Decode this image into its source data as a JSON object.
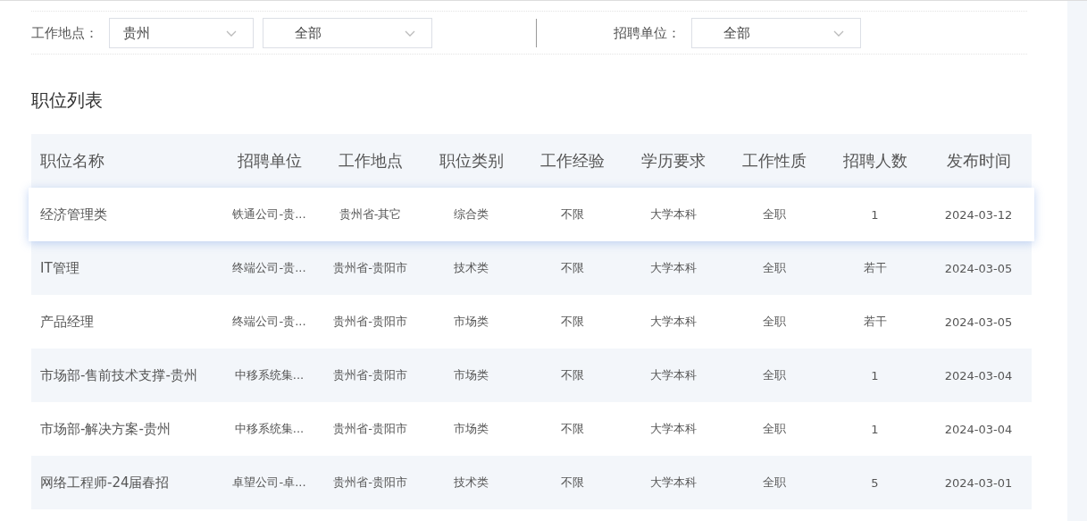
{
  "filters": [
    {
      "label": "工作地点：",
      "selects": [
        {
          "value": "贵州"
        },
        {
          "value": "全部"
        }
      ]
    },
    {
      "label": "招聘单位：",
      "selects": [
        {
          "value": "全部"
        }
      ]
    }
  ],
  "section_title": "职位列表",
  "table": {
    "columns": [
      "职位名称",
      "招聘单位",
      "工作地点",
      "职位类别",
      "工作经验",
      "学历要求",
      "工作性质",
      "招聘人数",
      "发布时间"
    ],
    "rows": [
      {
        "hovered": true,
        "cells": [
          "经济管理类",
          "铁通公司-贵...",
          "贵州省-其它",
          "综合类",
          "不限",
          "大学本科",
          "全职",
          "1",
          "2024-03-12"
        ]
      },
      {
        "hovered": false,
        "cells": [
          "IT管理",
          "终端公司-贵...",
          "贵州省-贵阳市",
          "技术类",
          "不限",
          "大学本科",
          "全职",
          "若干",
          "2024-03-05"
        ]
      },
      {
        "hovered": false,
        "cells": [
          "产品经理",
          "终端公司-贵...",
          "贵州省-贵阳市",
          "市场类",
          "不限",
          "大学本科",
          "全职",
          "若干",
          "2024-03-05"
        ]
      },
      {
        "hovered": false,
        "cells": [
          "市场部-售前技术支撑-贵州",
          "中移系统集...",
          "贵州省-贵阳市",
          "市场类",
          "不限",
          "大学本科",
          "全职",
          "1",
          "2024-03-04"
        ]
      },
      {
        "hovered": false,
        "cells": [
          "市场部-解决方案-贵州",
          "中移系统集...",
          "贵州省-贵阳市",
          "市场类",
          "不限",
          "大学本科",
          "全职",
          "1",
          "2024-03-04"
        ]
      },
      {
        "hovered": false,
        "cells": [
          "网络工程师-24届春招",
          "卓望公司-卓...",
          "贵州省-贵阳市",
          "技术类",
          "不限",
          "大学本科",
          "全职",
          "5",
          "2024-03-01"
        ]
      }
    ]
  }
}
